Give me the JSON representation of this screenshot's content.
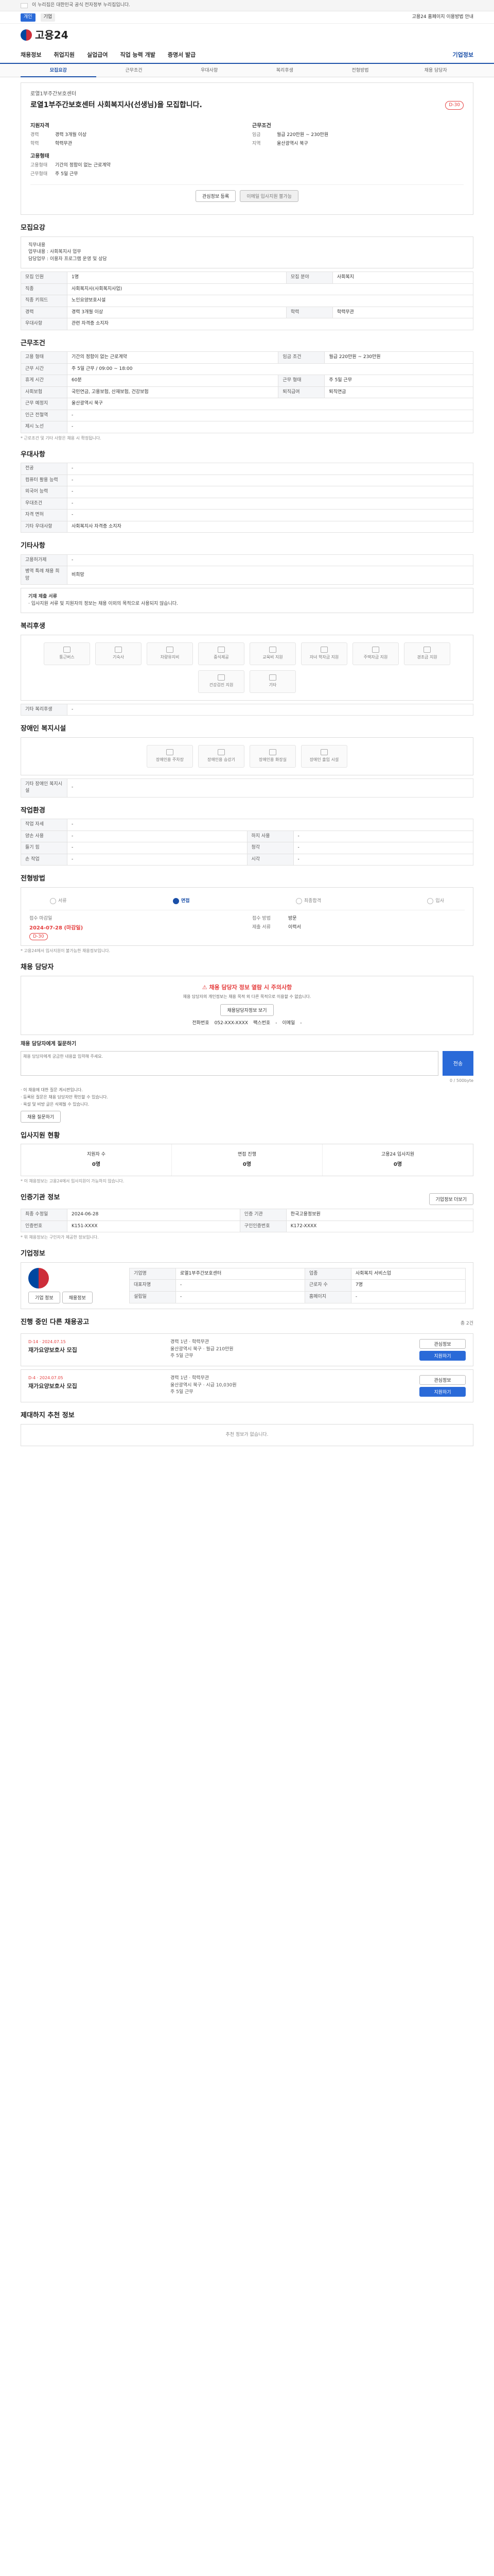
{
  "gov": {
    "text": "이 누리집은 대한민국 공식 전자정부 누리집입니다."
  },
  "topbar": {
    "left": "개인",
    "tag1": "기업",
    "right_link": "고용24 홈페이지 이용방법 안내"
  },
  "logo": {
    "text": "고용24"
  },
  "gnb": {
    "items": [
      "채용정보",
      "취업지원",
      "실업급여",
      "직업 능력 개발",
      "증명서 발급"
    ],
    "sub": "기업정보"
  },
  "tabs": [
    "모집요강",
    "근무조건",
    "우대사항",
    "복리후생",
    "전형방법",
    "채용 담당자"
  ],
  "summary": {
    "company": "로열1부주간보호센터",
    "title": "로열1부주간보호센터 사회복지사(선생님)을 모집합니다.",
    "dday": "D-30",
    "left_heading": "지원자격",
    "right_heading": "근무조건",
    "left": [
      {
        "k": "경력",
        "v": "경력 3개월 이상"
      },
      {
        "k": "학력",
        "v": "학력무관"
      }
    ],
    "right": [
      {
        "k": "임금",
        "v": "월급 220만원 ~ 230만원"
      },
      {
        "k": "지역",
        "v": "울산광역시 북구"
      }
    ],
    "left2_heading": "고용형태",
    "left2": [
      {
        "k": "고용형태",
        "v": "기간의 정함이 없는 근로계약"
      },
      {
        "k": "근무형태",
        "v": "주 5일 근무"
      }
    ],
    "btn_scrap": "관심정보 등록",
    "btn_apply": "이메일 입사지원 불가능"
  },
  "recruit": {
    "title": "모집요강",
    "desc": "직무내용\n업무내용 : 사회복지사 업무\n담당업무 : 이용자 프로그램 운영 및 상담",
    "rows": [
      {
        "k": "모집 인원",
        "v": "1명",
        "k2": "모집 분야",
        "v2": "사회복지"
      },
      {
        "k": "직종",
        "v": "사회복지사(사회복지사업)",
        "k2": "",
        "v2": ""
      },
      {
        "k": "직종 키워드",
        "v": "노인요양보호시설",
        "k2": "",
        "v2": ""
      },
      {
        "k": "경력",
        "v": "경력 3개월 이상",
        "k2": "학력",
        "v2": "학력무관"
      },
      {
        "k": "우대사항",
        "v": "관련 자격증 소지자",
        "k2": "",
        "v2": ""
      }
    ]
  },
  "work": {
    "title": "근무조건",
    "rows": [
      {
        "k": "고용 형태",
        "v": "기간의 정함이 없는 근로계약",
        "k2": "임금 조건",
        "v2": "월급 220만원 ~ 230만원"
      },
      {
        "k": "근무 시간",
        "v": "주 5일 근무 / 09:00 ~ 18:00",
        "k2": "",
        "v2": ""
      },
      {
        "k": "휴게 시간",
        "v": "60분",
        "k2": "근무 형태",
        "v2": "주 5일 근무"
      },
      {
        "k": "사회보험",
        "v": "국민연금, 고용보험, 산재보험, 건강보험",
        "k2": "퇴직급여",
        "v2": "퇴직연금"
      },
      {
        "k": "근무 예정지",
        "v": "울산광역시 북구",
        "k2": "",
        "v2": ""
      },
      {
        "k": "인근 전철역",
        "v": "-",
        "k2": "",
        "v2": ""
      },
      {
        "k": "제시 노선",
        "v": "-",
        "k2": "",
        "v2": ""
      }
    ],
    "note": "* 근로조건 및 기타 사항은 채용 시 확정됩니다."
  },
  "pref": {
    "title": "우대사항",
    "rows": [
      {
        "k": "전공",
        "v": "-"
      },
      {
        "k": "컴퓨터 활용 능력",
        "v": "-"
      },
      {
        "k": "외국어 능력",
        "v": "-"
      },
      {
        "k": "우대조건",
        "v": "-"
      },
      {
        "k": "자격 면허",
        "v": "-"
      },
      {
        "k": "기타 우대사항",
        "v": "사회복지사 자격증 소지자"
      }
    ]
  },
  "etc": {
    "title": "기타사항",
    "rows": [
      {
        "k": "고용허가제",
        "v": "-"
      },
      {
        "k": "병역 특례 채용 희망",
        "v": "비희망"
      }
    ],
    "notice_title": "기재 제출 서류",
    "notice": "· 입사지원 서류 및 지원자의 정보는 채용 이외의 목적으로 사용되지 않습니다."
  },
  "welfare": {
    "title": "복리후생",
    "items": [
      "통근버스",
      "기숙사",
      "차량유지비",
      "중식제공",
      "교육비 지원",
      "자녀 학자금 지원",
      "주택자금 지원",
      "경조금 지원",
      "건강검진 지원",
      "기타"
    ],
    "extra_label": "기타 복리후생",
    "extra": "-"
  },
  "disabled": {
    "title": "장애인 복지시설",
    "items": [
      "장애인용 주차장",
      "장애인용 승강기",
      "장애인용 화장실",
      "장애인 출입 시설"
    ],
    "extra_label": "기타 장애인 복지시설",
    "extra": "-"
  },
  "env": {
    "title": "작업환경",
    "rows": [
      {
        "k": "작업 자세",
        "v": "-",
        "k2": "",
        "v2": ""
      },
      {
        "k": "양손 사용",
        "v": "-",
        "k2": "하지 사용",
        "v2": "-"
      },
      {
        "k": "들기 힘",
        "v": "-",
        "k2": "청각",
        "v2": "-"
      },
      {
        "k": "손 작업",
        "v": "-",
        "k2": "시각",
        "v2": "-"
      }
    ]
  },
  "process": {
    "title": "전형방법",
    "steps": [
      "서류",
      "면접",
      "최종합격",
      "입사"
    ],
    "receipt_label": "접수 마감일",
    "receipt_date": "2024-07-28 (마감일)",
    "dday": "D-30",
    "method_label": "접수 방법",
    "method": "방문",
    "docs_label": "제출 서류",
    "docs": "이력서",
    "note": "* 고용24에서 입사지원이 불가능한 채용정보입니다."
  },
  "contact": {
    "title": "채용 담당자",
    "alert_head": "채용 담당자 정보 열람 시 주의사항",
    "alert_sub": "채용 담당자의 개인정보는 채용 목적 외 다른 목적으로 이용할 수 없습니다.",
    "btn_view": "채용담당자정보 보기",
    "phone_label": "전화번호",
    "phone": "052-XXX-XXXX",
    "fax_label": "팩스번호",
    "fax": "-",
    "email_label": "이메일",
    "email": "-",
    "qa_title": "채용 담당자에게 질문하기",
    "qa_placeholder": "채용 담당자에게 궁금한 내용을 입력해 주세요.",
    "qa_send": "전송",
    "qa_count": "0 / 500byte",
    "bullets": [
      "· 이 채용에 대한 질문 게시판입니다.",
      "· 등록된 질문은 채용 담당자만 확인할 수 있습니다.",
      "· 욕설 및 비방 글은 삭제될 수 있습니다."
    ],
    "btn_qa": "채용 질문하기"
  },
  "status": {
    "title": "입사지원 현황",
    "items": [
      {
        "label": "지원자 수",
        "v": "0명"
      },
      {
        "label": "면접 진행",
        "v": "0명"
      },
      {
        "label": "고용24 입사지원",
        "v": "0명"
      }
    ],
    "note": "* 이 채용정보는 고용24에서 입사지원이 가능하지 않습니다."
  },
  "info": {
    "title": "인증기관 정보",
    "btn": "기업정보 더보기",
    "rows": [
      {
        "k": "최종 수정일",
        "v": "2024-06-28",
        "k2": "인증 기관",
        "v2": "한국고용정보원"
      },
      {
        "k": "인증번호",
        "v": "K151-XXXX",
        "k2": "구인인증번호",
        "v2": "K172-XXXX"
      }
    ],
    "note": "* 위 채용정보는 구인자가 제공한 정보입니다."
  },
  "company_info": {
    "title": "기업정보",
    "btn1": "기업 정보",
    "btn2": "채용정보",
    "rows": [
      {
        "k": "기업명",
        "v": "로열1부주간보호센터",
        "k2": "업종",
        "v2": "사회복지 서비스업"
      },
      {
        "k": "대표자명",
        "v": "-",
        "k2": "근로자 수",
        "v2": "7명"
      },
      {
        "k": "설립일",
        "v": "-",
        "k2": "홈페이지",
        "v2": "-"
      }
    ]
  },
  "jobs": {
    "title": "진행 중인 다른 채용공고",
    "total_label": "총 2건",
    "cards": [
      {
        "dday": "D-14 · 2024.07.15",
        "title": "재가요양보호사 모집",
        "meta1": "경력 1년 · 학력무관",
        "meta2": "울산광역시 북구 · 월급 210만원",
        "meta3": "주 5일 근무",
        "b1": "관심정보",
        "b2": "지원하기"
      },
      {
        "dday": "D-4 · 2024.07.05",
        "title": "재가요양보호사 모집",
        "meta1": "경력 1년 · 학력무관",
        "meta2": "울산광역시 북구 · 시급 10,030원",
        "meta3": "주 5일 근무",
        "b1": "관심정보",
        "b2": "지원하기"
      }
    ]
  },
  "recommend": {
    "title": "제대하지 추천 정보",
    "empty": "추천 정보가 없습니다."
  }
}
